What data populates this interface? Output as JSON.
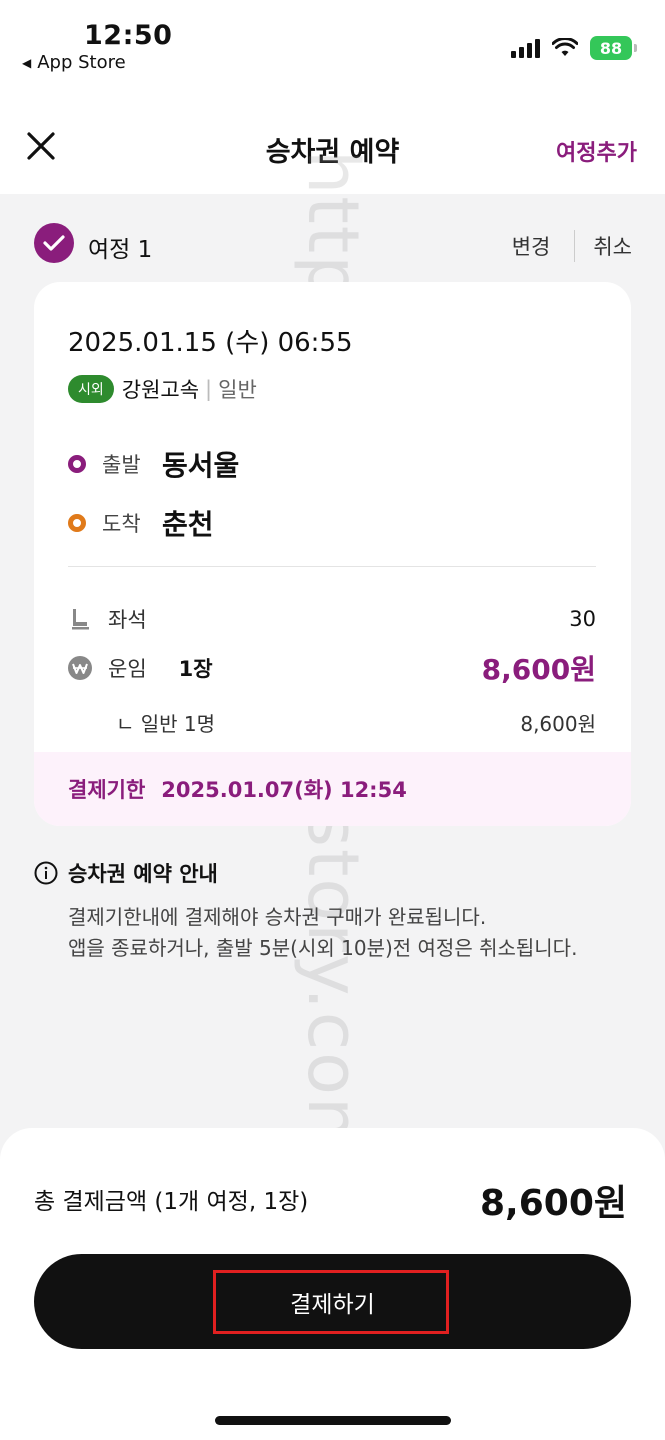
{
  "status_bar": {
    "time": "12:50",
    "back_app": "App Store",
    "battery": "88"
  },
  "header": {
    "title": "승차권 예약",
    "add_trip": "여정추가"
  },
  "trip": {
    "label": "여정 1",
    "change": "변경",
    "cancel": "취소"
  },
  "card": {
    "datetime": "2025.01.15 (수) 06:55",
    "badge": "시외",
    "operator": "강원고속",
    "separator": "|",
    "grade": "일반",
    "departure_role": "출발",
    "departure_place": "동서울",
    "arrival_role": "도착",
    "arrival_place": "춘천",
    "seat_label": "좌석",
    "seat_value": "30",
    "fare_label": "운임",
    "fare_count": "1장",
    "fare_value": "8,600원",
    "sub_label": "ㄴ 일반 1명",
    "sub_value": "8,600원",
    "deadline_label": "결제기한",
    "deadline_value": "2025.01.07(화) 12:54"
  },
  "notice": {
    "title": "승차권 예약 안내",
    "line1": "결제기한내에 결제해야 승차권 구매가 완료됩니다.",
    "line2": "앱을 종료하거나, 출발 5분(시외 10분)전 여정은 취소됩니다."
  },
  "bottom": {
    "total_label": "총 결제금액 (1개 여정, 1장)",
    "total_amount": "8,600원",
    "pay_button": "결제하기"
  },
  "watermark": "https://heal-you.tistory.com",
  "colors": {
    "accent": "#8a1d7c",
    "departure_dot": "#8a1d7c",
    "arrival_dot": "#e07a1a",
    "badge": "#2e8b2e",
    "highlight": "#e02020"
  }
}
